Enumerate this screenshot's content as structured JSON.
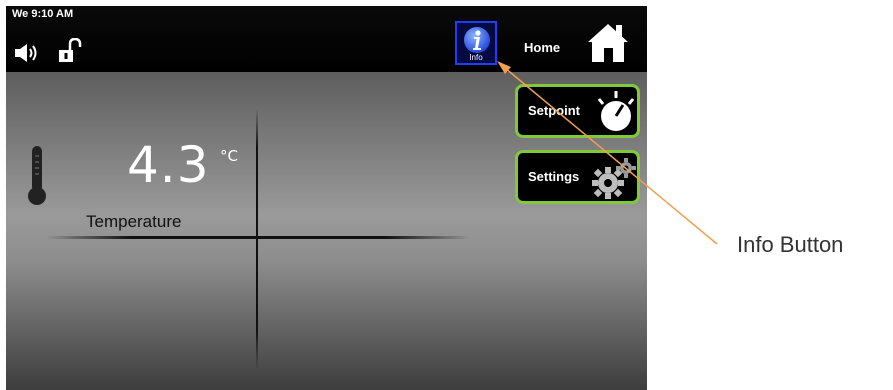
{
  "status_bar": {
    "clock": "We 9:10 AM",
    "info_label": "Info",
    "home_label": "Home"
  },
  "main": {
    "temperature_value": "4.3",
    "temperature_unit": "°C",
    "temperature_label": "Temperature"
  },
  "side_buttons": {
    "setpoint_label": "Setpoint",
    "settings_label": "Settings"
  },
  "callout": {
    "text": "Info Button"
  },
  "colors": {
    "button_border": "#7fc93b",
    "info_border": "#1f3cff",
    "callout_arrow": "#f0a050"
  }
}
